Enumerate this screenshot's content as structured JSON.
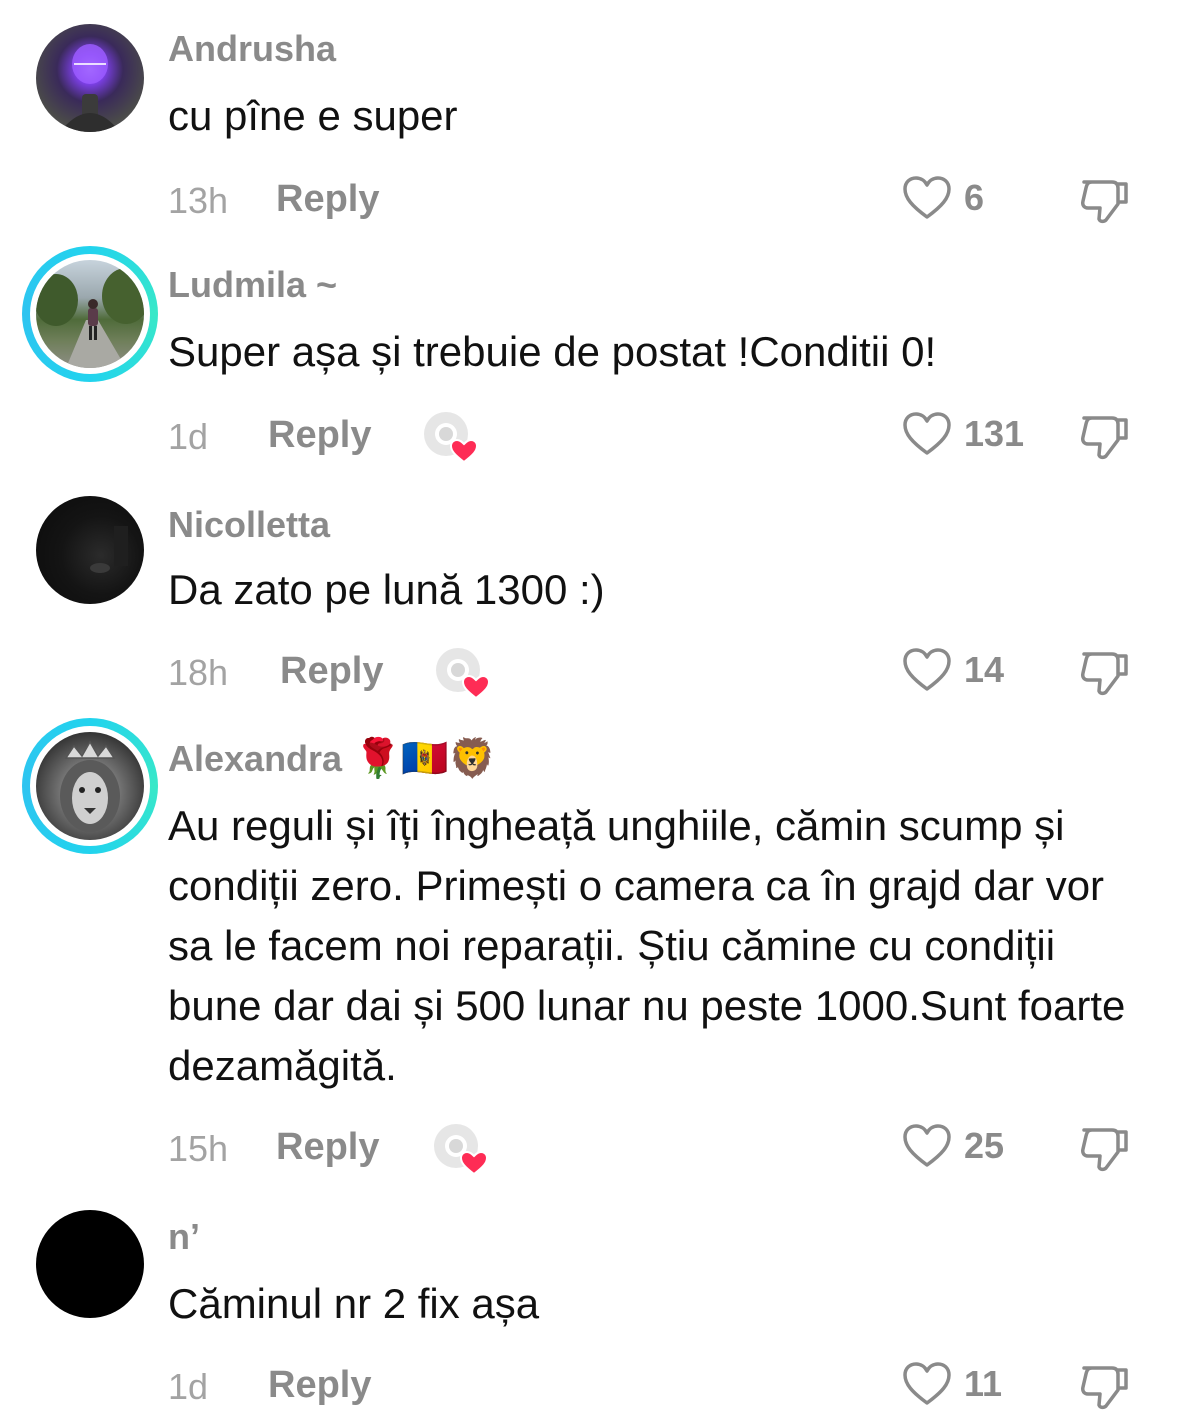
{
  "reply_label": "Reply",
  "comments": [
    {
      "author": "Andrusha",
      "text": "cu pîne e super",
      "time": "13h",
      "likes": "6",
      "creator_liked": false,
      "avatar": "purple-glow-selfie"
    },
    {
      "author": "Ludmila ~",
      "text": "Super așa și trebuie de postat !Conditii 0!",
      "time": "1d",
      "likes": "131",
      "creator_liked": true,
      "avatar": "park-walk-photo"
    },
    {
      "author": "Nicolletta",
      "text": "Da zato pe lună 1300 :)",
      "time": "18h",
      "likes": "14",
      "creator_liked": true,
      "avatar": "dark-photo"
    },
    {
      "author": "Alexandra",
      "author_emoji": "🌹🇲🇩🦁",
      "text": "Au reguli și îți îngheață unghiile, cămin scump și condiții zero. Primești o camera ca în grajd dar vor sa le facem noi reparații. Știu cămine cu condiții bune dar dai și 500 lunar nu peste 1000.Sunt foarte dezamăgită.",
      "time": "15h",
      "likes": "25",
      "creator_liked": true,
      "avatar": "lion-crown"
    },
    {
      "author": "n’",
      "text": "Căminul nr 2 fix așa",
      "time": "1d",
      "likes": "11",
      "creator_liked": false,
      "avatar": "black-circle"
    }
  ],
  "colors": {
    "accent_ring": "#22d3ee",
    "heart_badge": "#fe2c55",
    "meta_gray": "#8a8a8a"
  }
}
